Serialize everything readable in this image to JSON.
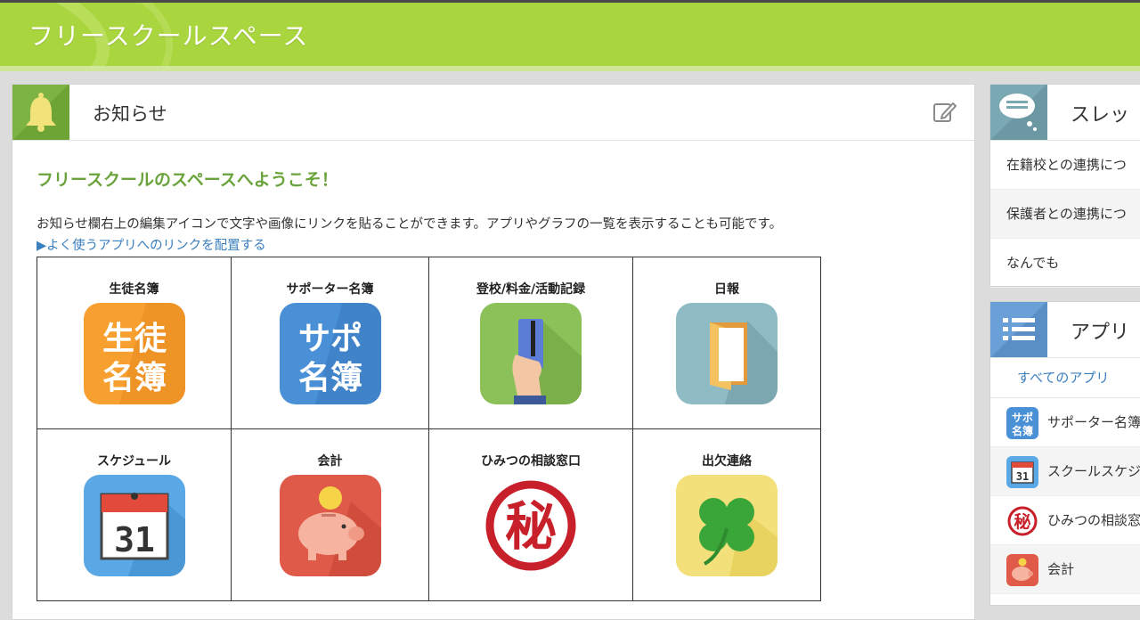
{
  "header": {
    "title": "フリースクールスペース"
  },
  "notice": {
    "title": "お知らせ",
    "welcome": "フリースクールのスペースへようこそ！",
    "description": "お知らせ欄右上の編集アイコンで文字や画像にリンクを貼ることができます。アプリやグラフの一覧を表示することも可能です。",
    "link": "▶よく使うアプリへのリンクを配置する",
    "apps": [
      {
        "label": "生徒名簿",
        "icon": "student-roster-icon",
        "glyph": [
          "生徒",
          "名簿"
        ]
      },
      {
        "label": "サポーター名簿",
        "icon": "supporter-roster-icon",
        "glyph": [
          "サポ",
          "名簿"
        ]
      },
      {
        "label": "登校/料金/活動記録",
        "icon": "card-hand-icon"
      },
      {
        "label": "日報",
        "icon": "door-icon"
      },
      {
        "label": "スケジュール",
        "icon": "calendar-icon",
        "glyph": "31"
      },
      {
        "label": "会計",
        "icon": "piggy-bank-icon"
      },
      {
        "label": "ひみつの相談窓口",
        "icon": "secret-seal-icon",
        "glyph": "秘"
      },
      {
        "label": "出欠連絡",
        "icon": "clover-icon"
      }
    ]
  },
  "threads": {
    "title": "スレッ",
    "icon": "speech-bubble-icon",
    "items": [
      "在籍校との連携につ",
      "保護者との連携につ",
      "なんでも"
    ]
  },
  "app_list": {
    "title": "アプリ",
    "icon": "list-icon",
    "all_link": "すべてのアプリ",
    "items": [
      {
        "label": "サポーター名簿",
        "icon": "supporter-roster-icon",
        "glyph": [
          "サポ",
          "名簿"
        ]
      },
      {
        "label": "スクールスケジ",
        "icon": "calendar-icon",
        "glyph": "31"
      },
      {
        "label": "ひみつの相談窓",
        "icon": "secret-seal-icon",
        "glyph": "秘"
      },
      {
        "label": "会計",
        "icon": "piggy-bank-icon"
      }
    ]
  },
  "colors": {
    "header_green": "#a9d53e",
    "accent_green": "#6aa33b",
    "link_blue": "#3b7fbf"
  }
}
